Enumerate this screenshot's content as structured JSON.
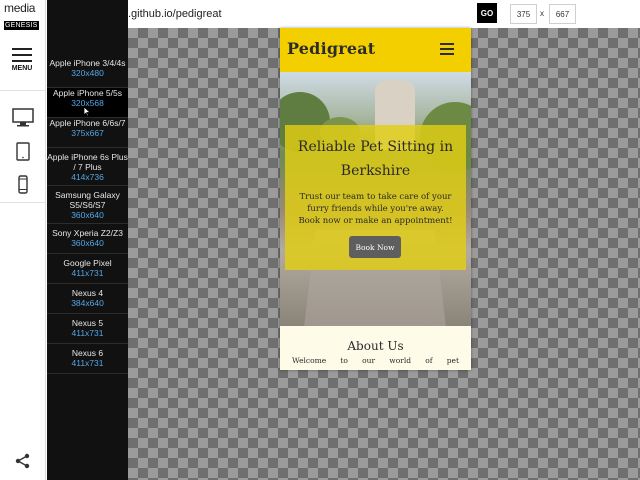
{
  "logo": {
    "line1": "media",
    "line2": "GENESIS"
  },
  "rail": {
    "menu_label": "MENU"
  },
  "devices": [
    {
      "name": "Apple iPhone 3/4/4s",
      "size": "320x480"
    },
    {
      "name": "Apple iPhone 5/5s",
      "size": "320x568"
    },
    {
      "name": "Apple iPhone 6/6s/7",
      "size": "375x667"
    },
    {
      "name": "Apple iPhone 6s Plus / 7 Plus",
      "size": "414x736"
    },
    {
      "name": "Samsung Galaxy S5/S6/S7",
      "size": "360x640"
    },
    {
      "name": "Sony Xperia Z2/Z3",
      "size": "360x640"
    },
    {
      "name": "Google Pixel",
      "size": "411x731"
    },
    {
      "name": "Nexus 4",
      "size": "384x640"
    },
    {
      "name": "Nexus 5",
      "size": "411x731"
    },
    {
      "name": "Nexus 6",
      "size": "411x731"
    }
  ],
  "active_device_index": 1,
  "topbar": {
    "url": ".github.io/pedigreat",
    "go_label": "GO",
    "width_value": "375",
    "x_label": "x",
    "height_value": "667"
  },
  "site": {
    "brand": "Pedigreat",
    "hero_title": "Reliable Pet Sitting in Berkshire",
    "hero_text": "Trust our team to take care of your furry friends while you're away. Book now or make an appointment!",
    "book_button": "Book Now",
    "about_title": "About Us",
    "about_text": "Welcome to our world of pet"
  },
  "colors": {
    "nav": "#f3cf00",
    "panel": "#111111",
    "size_text": "#55a7e6"
  },
  "icons": [
    "menu-icon",
    "desktop-icon",
    "tablet-icon",
    "phone-icon",
    "share-icon",
    "hamburger-icon",
    "cursor-icon"
  ]
}
